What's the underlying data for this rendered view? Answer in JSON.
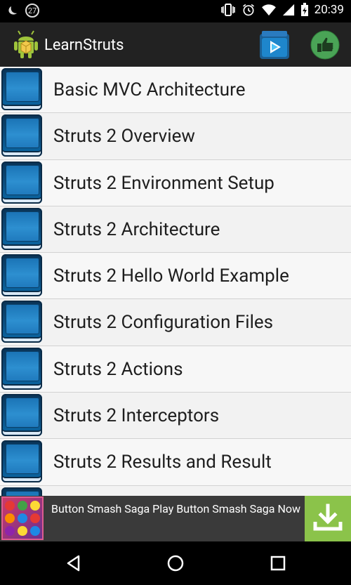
{
  "status_bar": {
    "notification_count": "27",
    "time": "20:39"
  },
  "app_bar": {
    "title": "LearnStruts"
  },
  "topics": [
    {
      "label": "Basic MVC Architecture"
    },
    {
      "label": "Struts 2 Overview"
    },
    {
      "label": "Struts 2 Environment Setup"
    },
    {
      "label": "Struts 2 Architecture"
    },
    {
      "label": "Struts 2 Hello World Example"
    },
    {
      "label": "Struts 2 Configuration Files"
    },
    {
      "label": "Struts 2 Actions"
    },
    {
      "label": "Struts 2 Interceptors"
    },
    {
      "label": "Struts 2 Results and Result"
    },
    {
      "label": ""
    }
  ],
  "ad_banner": {
    "text": "Button Smash Saga Play Button Smash Saga Now",
    "cta_icon": "download-icon",
    "colors": {
      "cta_bg": "#8bc34a",
      "banner_bg": "#3a3a3a"
    }
  },
  "icons": {
    "app_logo": "android-icon",
    "play_store": "play-store-icon",
    "rate": "thumbs-up-icon",
    "nav_back": "back-icon",
    "nav_home": "home-icon",
    "nav_recents": "recents-icon"
  }
}
